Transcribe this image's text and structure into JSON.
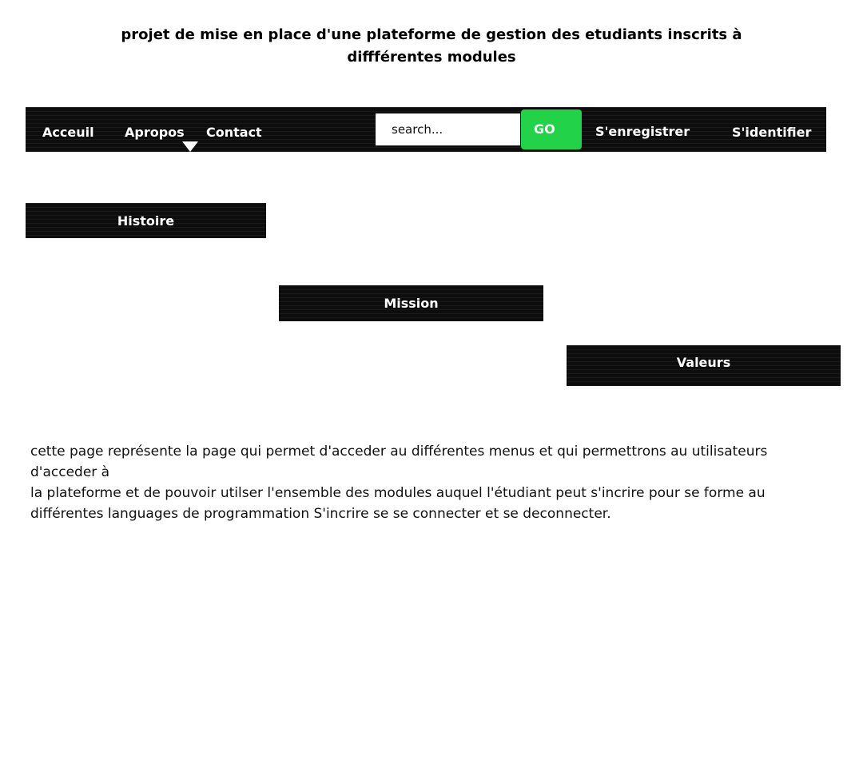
{
  "header": {
    "title": "projet de mise en place d'une plateforme de gestion des etudiants inscrits à diffférentes modules"
  },
  "navbar": {
    "links": [
      "Acceuil",
      "Apropos",
      "Contact"
    ],
    "search": {
      "placeholder": "search...",
      "value": ""
    },
    "go_label": "GO",
    "register_label": "S'enregistrer",
    "login_label": "S'identifier"
  },
  "sections": {
    "histoire": "Histoire",
    "mission": "Mission",
    "valeurs": "Valeurs"
  },
  "description": {
    "line1": "cette page représente la page qui permet d'acceder au différentes menus et qui permettrons au utilisateurs d'acceder à",
    "line2": "la plateforme et de pouvoir utilser  l'ensemble des modules auquel l'étudiant peut s'incrire  pour se forme au différentes  languages de programmation  S'incrire se se connecter et se deconnecter."
  },
  "colors": {
    "navbar_bg": "#0d0d0d",
    "go_button": "#22d34a",
    "text_on_dark": "#ffffff"
  }
}
